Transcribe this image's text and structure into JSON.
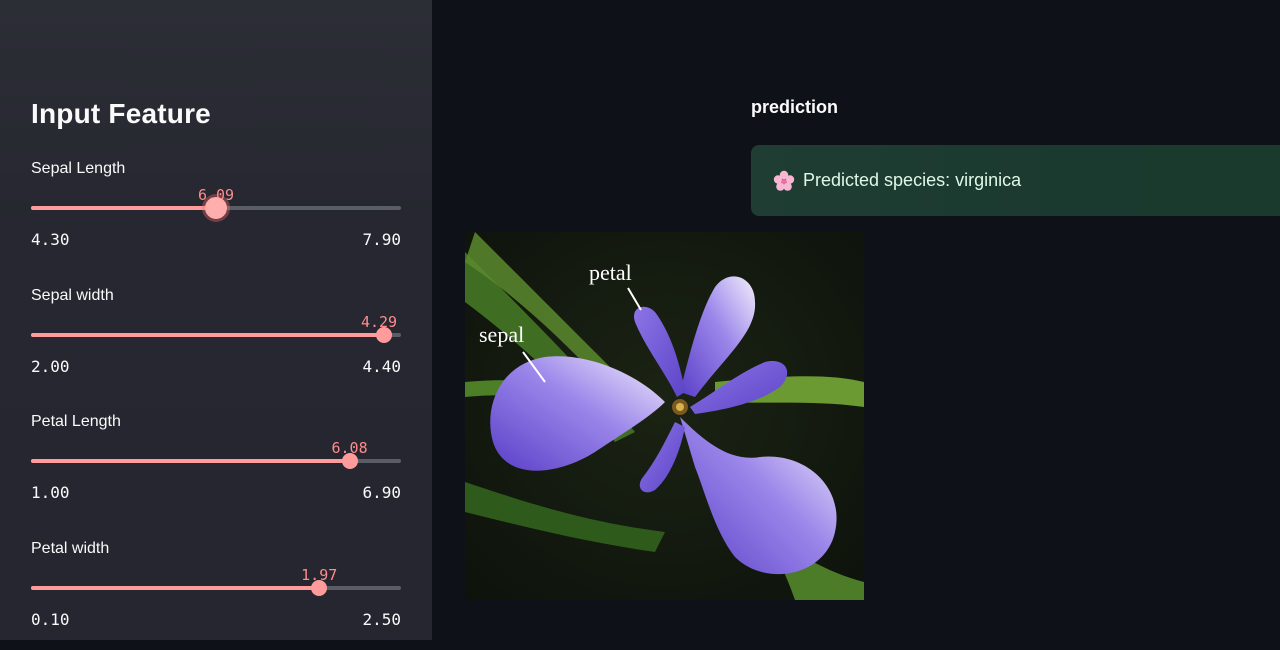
{
  "sidebar": {
    "title": "Input Feature",
    "sliders": [
      {
        "label": "Sepal Length",
        "value": "6.09",
        "min": "4.30",
        "max": "7.90",
        "fraction": 0.5,
        "active": true
      },
      {
        "label": "Sepal width",
        "value": "4.29",
        "min": "2.00",
        "max": "4.40",
        "fraction": 0.954,
        "active": false
      },
      {
        "label": "Petal Length",
        "value": "6.08",
        "min": "1.00",
        "max": "6.90",
        "fraction": 0.861,
        "active": false
      },
      {
        "label": "Petal width",
        "value": "1.97",
        "min": "0.10",
        "max": "2.50",
        "fraction": 0.779,
        "active": false
      }
    ]
  },
  "main": {
    "heading": "prediction",
    "alert": {
      "text": "Predicted species: virginica",
      "icon": "cherry-blossom-icon"
    },
    "figure": {
      "labels": {
        "petal": "petal",
        "sepal": "sepal"
      }
    }
  },
  "colors": {
    "accent": "#ff9b9b",
    "background": "#0e1117",
    "sidebar": "#262730",
    "success_bg": "#1b3a2f"
  }
}
